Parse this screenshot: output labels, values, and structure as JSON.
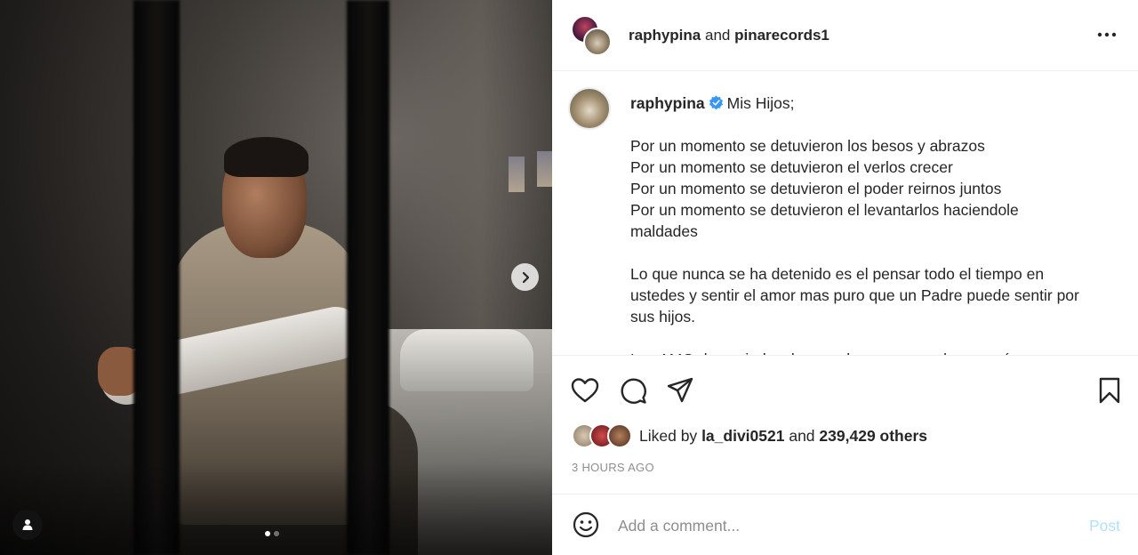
{
  "post": {
    "header": {
      "user1": "raphypina",
      "connector": "and",
      "user2": "pinarecords1"
    },
    "caption": {
      "username": "raphypina",
      "first_line": "Mis Hijos;",
      "lines_p1": [
        "Por un momento se detuvieron los besos y abrazos",
        "Por un momento se detuvieron el verlos crecer",
        "Por un momento se detuvieron el poder reirnos juntos",
        "Por un momento se detuvieron el levantarlos haciendole",
        "maldades"
      ],
      "lines_p2": [
        "Lo que nunca se ha detenido es el pensar todo el tiempo en",
        "ustedes y sentir el amor mas puro que un Padre puede sentir por",
        "sus hijos."
      ],
      "lines_p3": [
        "Los AMO demasiado y les quedan poco a su loco papá"
      ]
    },
    "likes": {
      "prefix": "Liked by",
      "user": "la_divi0521",
      "connector": "and",
      "count": "239,429 others"
    },
    "timestamp": "3 HOURS AGO",
    "comment": {
      "placeholder": "Add a comment...",
      "post_label": "Post"
    },
    "carousel": {
      "current": 1,
      "total": 2
    }
  },
  "colors": {
    "accent": "#0095f6",
    "post_disabled": "#b2dffc",
    "verified": "#3897f0",
    "muted": "#8e8e8e"
  },
  "icons": [
    "more-icon",
    "verified-icon",
    "heart-icon",
    "comment-icon",
    "share-icon",
    "bookmark-icon",
    "emoji-icon",
    "chevron-right-icon",
    "user-tag-icon"
  ]
}
